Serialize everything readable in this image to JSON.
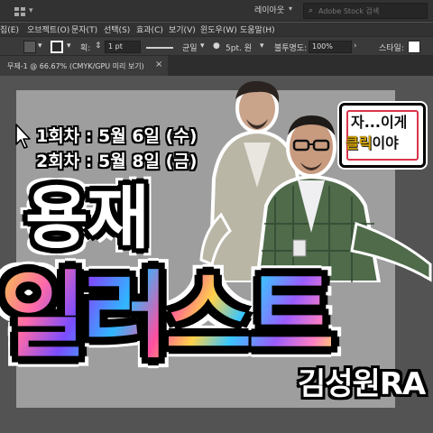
{
  "app": {
    "layout_switcher": "레이아웃",
    "search_placeholder": "Adobe Stock 검색",
    "search_icon": "magnifier-icon",
    "workspace_icon": "grid-icon"
  },
  "menu": {
    "items": [
      "집(E)",
      "오브젝트(O)",
      "문자(T)",
      "선택(S)",
      "효과(C)",
      "보기(V)",
      "윈도우(W)",
      "도움말(H)"
    ]
  },
  "control_bar": {
    "stroke_label": "획:",
    "stroke_weight": "1 pt",
    "profile_label": "균일",
    "brush_label": "5pt. 원",
    "opacity_label": "불투명도:",
    "opacity_value": "100%",
    "style_label": "스타일:",
    "fill_color": "#5a5a5a",
    "stroke_color": "#ffffff"
  },
  "document": {
    "tab_title": "무제-1 @ 66.67% (CMYK/GPU 미리 보기)",
    "close_glyph": "×"
  },
  "thumbnail": {
    "date_line_1": "1회차 : 5월 6일 (수)",
    "date_line_2": "2회차 : 5월 8일 (금)",
    "speech_line_1": "자...이게",
    "speech_highlight": "클릭",
    "speech_rest": "이야",
    "title_line_1": "용재",
    "title_line_2": "일러스트",
    "signature": "김성원RA"
  },
  "colors": {
    "ui_dark": "#323232",
    "canvas_gray": "#535353",
    "artboard": "#9e9e9e",
    "speech_border": "#d9364b",
    "highlight_yellow": "#d4a400"
  }
}
